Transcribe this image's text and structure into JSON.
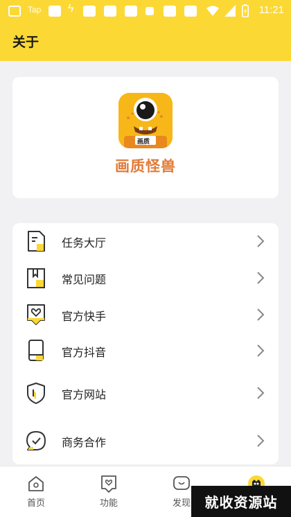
{
  "status_bar": {
    "carrier_text": "Tap",
    "time": "11:21"
  },
  "header": {
    "title": "关于"
  },
  "app_info": {
    "logo_label": "画质",
    "name": "画质怪兽"
  },
  "menu": {
    "items": [
      {
        "label": "任务大厅",
        "icon": "task-doc-icon"
      },
      {
        "label": "常见问题",
        "icon": "faq-book-icon"
      },
      {
        "label": "官方快手",
        "icon": "kuaishou-heart-icon"
      },
      {
        "label": "官方抖音",
        "icon": "phone-icon"
      },
      {
        "label": "官方网站",
        "icon": "shield-icon"
      },
      {
        "label": "商务合作",
        "icon": "chat-check-icon"
      }
    ]
  },
  "tabbar": {
    "tabs": [
      {
        "label": "首页",
        "icon": "home-icon"
      },
      {
        "label": "功能",
        "icon": "feature-heart-icon"
      },
      {
        "label": "发现",
        "icon": "discover-icon"
      },
      {
        "label": "",
        "icon": "monster-avatar-icon"
      }
    ]
  },
  "watermark": {
    "text": "就收资源站"
  },
  "colors": {
    "accent_yellow": "#fcd834",
    "brand_orange": "#e07a36"
  }
}
